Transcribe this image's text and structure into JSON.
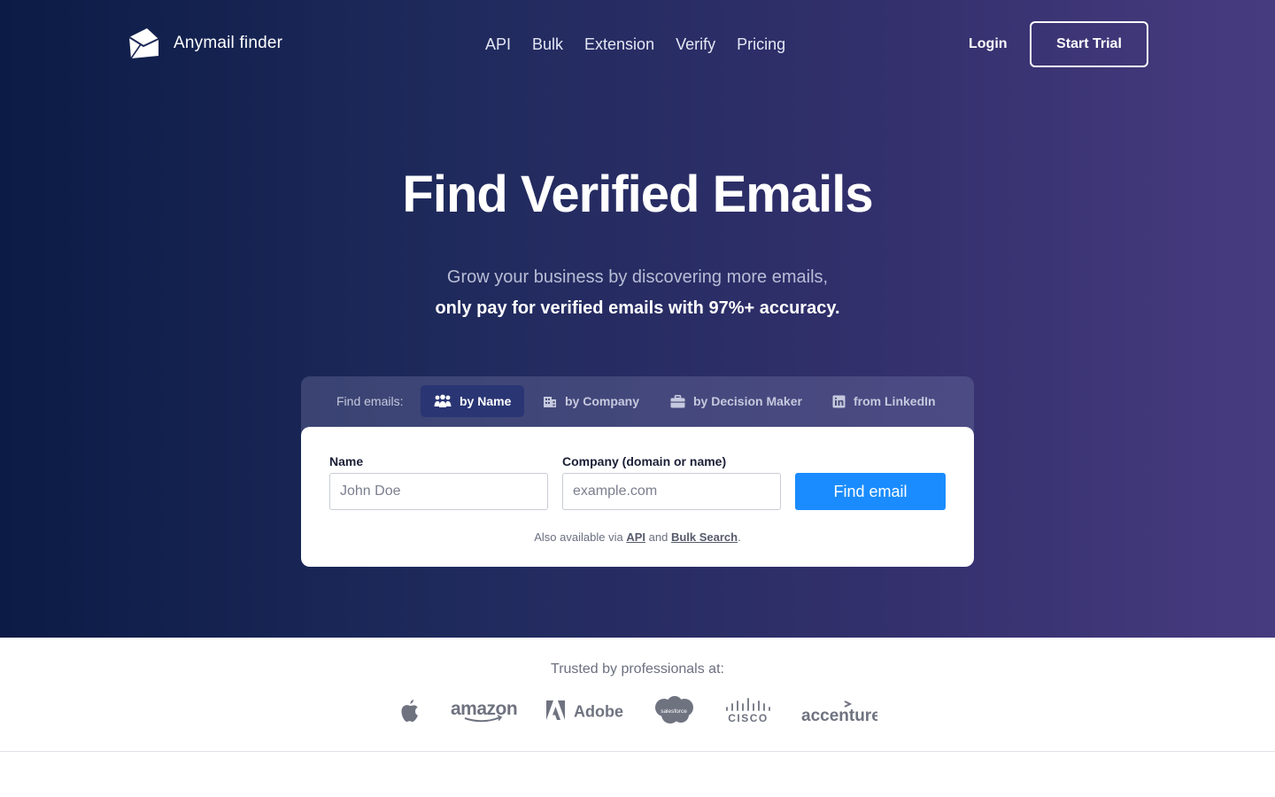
{
  "brand": {
    "name": "Anymail finder",
    "logo_icon": "envelope-logo-icon"
  },
  "nav": [
    {
      "label": "API"
    },
    {
      "label": "Bulk"
    },
    {
      "label": "Extension"
    },
    {
      "label": "Verify"
    },
    {
      "label": "Pricing"
    }
  ],
  "header": {
    "login_label": "Login",
    "start_trial_label": "Start Trial"
  },
  "hero": {
    "title": "Find Verified Emails",
    "subtitle_line1": "Grow your business by discovering more emails,",
    "subtitle_line2": "only pay for verified emails with 97%+ accuracy."
  },
  "search": {
    "tabs_label": "Find emails:",
    "tabs": [
      {
        "label": "by Name",
        "icon": "people-icon",
        "active": true
      },
      {
        "label": "by Company",
        "icon": "building-icon",
        "active": false
      },
      {
        "label": "by Decision Maker",
        "icon": "briefcase-icon",
        "active": false
      },
      {
        "label": "from LinkedIn",
        "icon": "linkedin-icon",
        "active": false
      }
    ],
    "name_label": "Name",
    "name_placeholder": "John Doe",
    "company_label": "Company (domain or name)",
    "company_placeholder": "example.com",
    "button_label": "Find email",
    "also_prefix": "Also available via",
    "also_api": "API",
    "also_and": "and",
    "also_bulk": "Bulk Search",
    "also_suffix": "."
  },
  "trusted": {
    "label": "Trusted by professionals at:",
    "brands": [
      {
        "name": "apple",
        "icon": "apple-logo-icon"
      },
      {
        "name": "amazon",
        "icon": "amazon-logo-icon"
      },
      {
        "name": "Adobe",
        "icon": "adobe-logo-icon"
      },
      {
        "name": "salesforce",
        "icon": "salesforce-logo-icon"
      },
      {
        "name": "cisco",
        "icon": "cisco-logo-icon"
      },
      {
        "name": "accenture",
        "icon": "accenture-logo-icon"
      }
    ]
  },
  "colors": {
    "hero_gradient_start": "#0b1b45",
    "hero_gradient_end": "#473b7f",
    "primary_button": "#1a8cff",
    "active_tab": "#2a3574"
  }
}
